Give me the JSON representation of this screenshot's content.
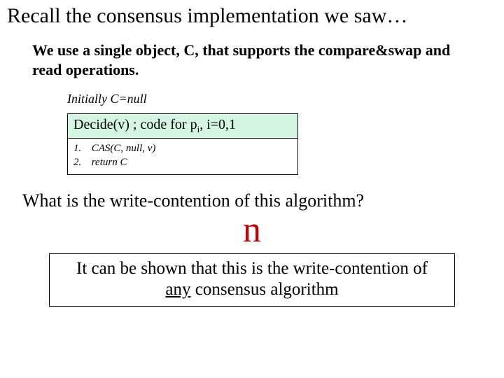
{
  "title": "Recall the consensus implementation we saw…",
  "intro": "We use a single object, C, that supports the compare&swap and read operations.",
  "initially": "Initially C=null",
  "code": {
    "header_pre": "Decide(v)  ; code for p",
    "header_sub": "i",
    "header_post": ", i=0,1",
    "line1_num": "1.",
    "line1_txt": "CAS(C, null, v)",
    "line2_num": "2.",
    "line2_txt": "return C"
  },
  "question": "What is the write-contention of this algorithm?",
  "answer": "n",
  "note_pre": "It can be shown that this is the write-contention of ",
  "note_ul": "any",
  "note_post": " consensus algorithm"
}
